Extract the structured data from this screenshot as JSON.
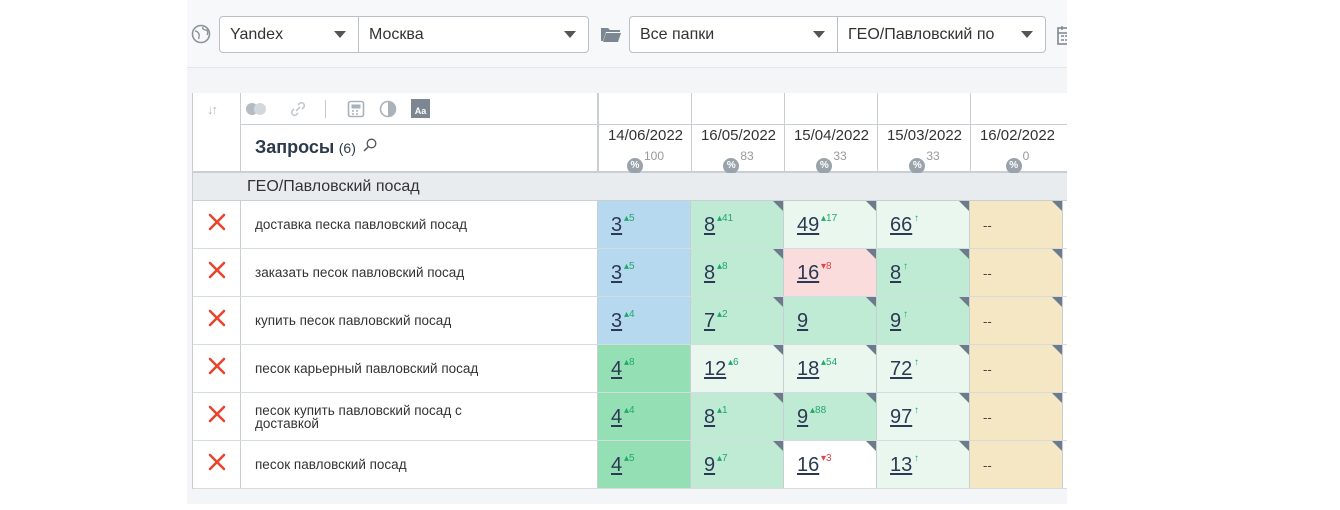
{
  "toolbar": {
    "engine": "Yandex",
    "region": "Москва",
    "folder": "Все папки",
    "group": "ГЕО/Павловский по"
  },
  "table": {
    "queries_label": "Запросы",
    "queries_count": "(6)",
    "columns": [
      {
        "date": "14/06/2022",
        "pct": "100"
      },
      {
        "date": "16/05/2022",
        "pct": "83"
      },
      {
        "date": "15/04/2022",
        "pct": "33"
      },
      {
        "date": "15/03/2022",
        "pct": "33"
      },
      {
        "date": "16/02/2022",
        "pct": "0"
      }
    ],
    "group_name": "ГЕО/Павловский посад",
    "rows": [
      {
        "query": "доставка песка павловский посад",
        "cells": [
          {
            "pos": "3",
            "chg": "5",
            "dir": "up",
            "bg": "#b6d9f0"
          },
          {
            "pos": "8",
            "chg": "41",
            "dir": "up",
            "bg": "#bfead4"
          },
          {
            "pos": "49",
            "chg": "17",
            "dir": "up",
            "bg": "#eaf7ef"
          },
          {
            "pos": "66",
            "chg": "",
            "dir": "up",
            "bg": "#eaf7ef"
          },
          {
            "pos": "--",
            "chg": "",
            "dir": "",
            "bg": "#f5e6c4"
          }
        ]
      },
      {
        "query": "заказать песок павловский посад",
        "cells": [
          {
            "pos": "3",
            "chg": "5",
            "dir": "up",
            "bg": "#b6d9f0"
          },
          {
            "pos": "8",
            "chg": "8",
            "dir": "up",
            "bg": "#bfead4"
          },
          {
            "pos": "16",
            "chg": "8",
            "dir": "down",
            "bg": "#fbdcdc"
          },
          {
            "pos": "8",
            "chg": "",
            "dir": "up",
            "bg": "#bfead4"
          },
          {
            "pos": "--",
            "chg": "",
            "dir": "",
            "bg": "#f5e6c4"
          }
        ]
      },
      {
        "query": "купить песок павловский посад",
        "cells": [
          {
            "pos": "3",
            "chg": "4",
            "dir": "up",
            "bg": "#b6d9f0"
          },
          {
            "pos": "7",
            "chg": "2",
            "dir": "up",
            "bg": "#bfead4"
          },
          {
            "pos": "9",
            "chg": "",
            "dir": "",
            "bg": "#bfead4"
          },
          {
            "pos": "9",
            "chg": "",
            "dir": "up",
            "bg": "#bfead4"
          },
          {
            "pos": "--",
            "chg": "",
            "dir": "",
            "bg": "#f5e6c4"
          }
        ]
      },
      {
        "query": "песок карьерный павловский посад",
        "cells": [
          {
            "pos": "4",
            "chg": "8",
            "dir": "up",
            "bg": "#94e0b4"
          },
          {
            "pos": "12",
            "chg": "6",
            "dir": "up",
            "bg": "#eaf7ef"
          },
          {
            "pos": "18",
            "chg": "54",
            "dir": "up",
            "bg": "#eaf7ef"
          },
          {
            "pos": "72",
            "chg": "",
            "dir": "up",
            "bg": "#eaf7ef"
          },
          {
            "pos": "--",
            "chg": "",
            "dir": "",
            "bg": "#f5e6c4"
          }
        ]
      },
      {
        "query": "песок купить павловский посад с доставкой",
        "cells": [
          {
            "pos": "4",
            "chg": "4",
            "dir": "up",
            "bg": "#94e0b4"
          },
          {
            "pos": "8",
            "chg": "1",
            "dir": "up",
            "bg": "#bfead4"
          },
          {
            "pos": "9",
            "chg": "88",
            "dir": "up",
            "bg": "#bfead4"
          },
          {
            "pos": "97",
            "chg": "",
            "dir": "up",
            "bg": "#eaf7ef"
          },
          {
            "pos": "--",
            "chg": "",
            "dir": "",
            "bg": "#f5e6c4"
          }
        ]
      },
      {
        "query": "песок павловский посад",
        "cells": [
          {
            "pos": "4",
            "chg": "5",
            "dir": "up",
            "bg": "#94e0b4"
          },
          {
            "pos": "9",
            "chg": "7",
            "dir": "up",
            "bg": "#bfead4"
          },
          {
            "pos": "16",
            "chg": "3",
            "dir": "down",
            "bg": "#ffffff"
          },
          {
            "pos": "13",
            "chg": "",
            "dir": "up",
            "bg": "#eaf7ef"
          },
          {
            "pos": "--",
            "chg": "",
            "dir": "",
            "bg": "#f5e6c4"
          }
        ]
      }
    ]
  }
}
